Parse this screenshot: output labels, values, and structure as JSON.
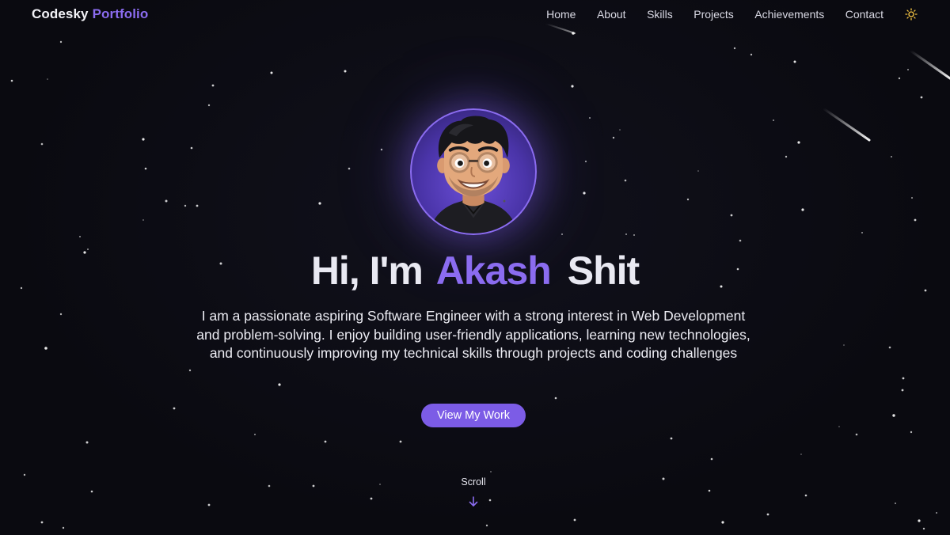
{
  "brand": {
    "name": "Codesky",
    "accent": "Portfolio"
  },
  "nav": {
    "items": [
      {
        "label": "Home"
      },
      {
        "label": "About"
      },
      {
        "label": "Skills"
      },
      {
        "label": "Projects"
      },
      {
        "label": "Achievements"
      },
      {
        "label": "Contact"
      }
    ],
    "theme_toggle_icon": "sun-icon"
  },
  "hero": {
    "greeting": "Hi, I'm",
    "first_name": "Akash",
    "last_name": "Shit",
    "description": "I am a passionate aspiring Software Engineer with a strong interest in Web Development and problem-solving. I enjoy building user-friendly applications, learning new technologies, and continuously improving my technical skills through projects and coding challenges",
    "cta_label": "View My Work",
    "scroll_label": "Scroll",
    "scroll_icon": "arrow-down-icon",
    "avatar_icon": "avatar-illustration"
  },
  "colors": {
    "background": "#0b0b12",
    "accent": "#8b6cf0",
    "button": "#7c5ce6",
    "text": "#e9e9f2"
  }
}
